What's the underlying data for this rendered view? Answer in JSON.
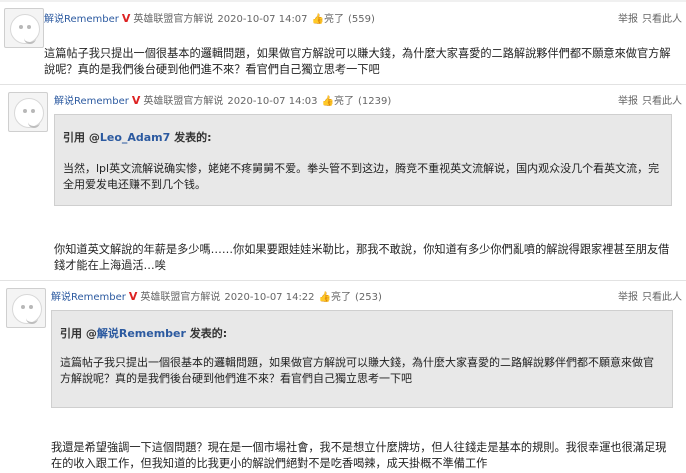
{
  "posts": [
    {
      "user": "解说Remember",
      "v": "V",
      "title": "英雄联盟官方解说",
      "time": "2020-10-07 14:07",
      "likes_label": "亮了",
      "likes": "(559)",
      "report": "举报",
      "only": "只看此人",
      "body": "這篇帖子我只提出一個很基本的邏輯問題，如果做官方解說可以賺大錢，為什麼大家喜愛的二路解說夥伴們都不願意來做官方解說呢？真的是我們後台硬到他們進不來？看官們自己獨立思考一下吧"
    },
    {
      "user": "解说Remember",
      "v": "V",
      "title": "英雄联盟官方解说",
      "time": "2020-10-07 14:03",
      "likes_label": "亮了",
      "likes": "(1239)",
      "report": "举报",
      "only": "只看此人",
      "quote_prefix": "引用 @",
      "quote_user": "Leo_Adam7",
      "quote_suffix": " 发表的:",
      "quote_body": "当然，lpl英文流解说确实惨，姥姥不疼舅舅不爱。拳头管不到这边，腾竞不重视英文流解说，国内观众没几个看英文流，完全用爱发电还赚不到几个钱。",
      "body": "你知道英文解說的年薪是多少嗎……你如果要跟娃娃米勒比，那我不敢說，你知道有多少你們亂噴的解說得跟家裡甚至朋友借錢才能在上海過活…唉"
    },
    {
      "user": "解说Remember",
      "v": "V",
      "title": "英雄联盟官方解说",
      "time": "2020-10-07 14:22",
      "likes_label": "亮了",
      "likes": "(253)",
      "report": "举报",
      "only": "只看此人",
      "quote_prefix": "引用 @",
      "quote_user": "解说Remember",
      "quote_suffix": " 发表的:",
      "quote_body": "這篇帖子我只提出一個很基本的邏輯問題，如果做官方解說可以賺大錢，為什麼大家喜愛的二路解說夥伴們都不願意來做官方解說呢？真的是我們後台硬到他們進不來？看官們自己獨立思考一下吧",
      "body": "我還是希望強調一下這個問題？現在是一個市場社會，我不是想立什麼牌坊，但人往錢走是基本的規則。我很幸運也很滿足現在的收入跟工作，但我知道的比我更小的解說們絕對不是吃香喝辣，成天掛概不準備工作"
    }
  ]
}
